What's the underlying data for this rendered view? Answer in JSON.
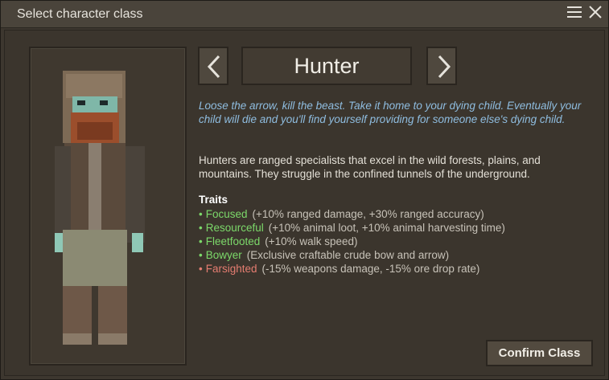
{
  "window": {
    "title": "Select character class",
    "menu_icon": "hamburger-menu-icon",
    "close_icon": "close-icon"
  },
  "class_selector": {
    "name": "Hunter",
    "prev_icon": "chevron-left-icon",
    "next_icon": "chevron-right-icon"
  },
  "lore": "Loose the arrow, kill the beast. Take it home to your dying child. Eventually your child will die and you'll find yourself providing for someone else's dying child.",
  "description": "Hunters are ranged specialists that excel in the wild forests, plains, and mountains. They struggle in the confined tunnels of the underground.",
  "traits": {
    "heading": "Traits",
    "items": [
      {
        "bullet": "•",
        "name": "Focused",
        "effect": "(+10% ranged damage, +30% ranged accuracy)",
        "positive": true
      },
      {
        "bullet": "•",
        "name": "Resourceful",
        "effect": "(+10% animal loot, +10% animal harvesting time)",
        "positive": true
      },
      {
        "bullet": "•",
        "name": "Fleetfooted",
        "effect": "(+10% walk speed)",
        "positive": true
      },
      {
        "bullet": "•",
        "name": "Bowyer",
        "effect": "(Exclusive craftable crude bow and arrow)",
        "positive": true
      },
      {
        "bullet": "•",
        "name": "Farsighted",
        "effect": "(-15% weapons damage, -15% ore drop rate)",
        "positive": false
      }
    ]
  },
  "confirm_label": "Confirm Class",
  "colors": {
    "positive_trait": "#7cd96a",
    "negative_trait": "#e57d71",
    "lore_text": "#8fbde0",
    "panel_bg": "#3d372f"
  }
}
